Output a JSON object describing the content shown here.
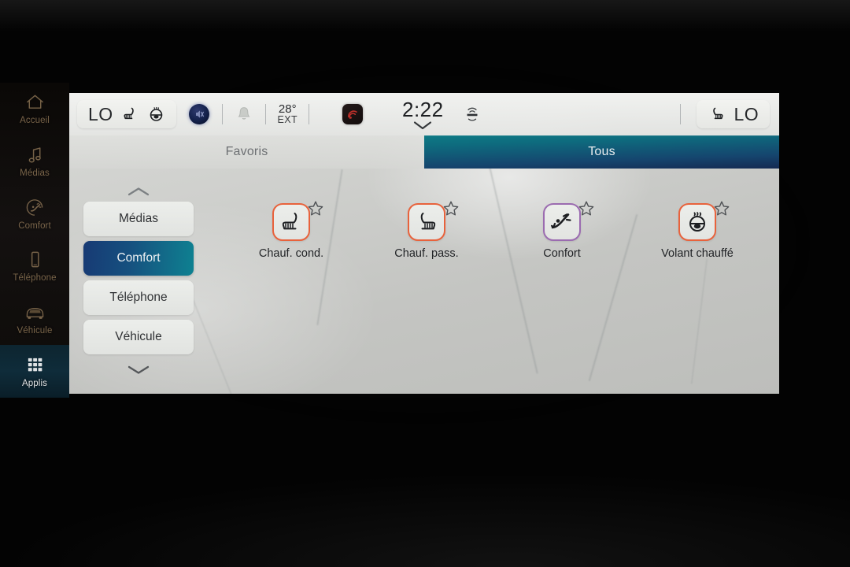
{
  "sidebar": {
    "items": [
      {
        "label": "Accueil",
        "icon": "home-icon",
        "active": false
      },
      {
        "label": "Médias",
        "icon": "music-note-icon",
        "active": false
      },
      {
        "label": "Comfort",
        "icon": "comfort-seat-icon",
        "active": false
      },
      {
        "label": "Téléphone",
        "icon": "phone-icon",
        "active": false
      },
      {
        "label": "Véhicule",
        "icon": "vehicle-icon",
        "active": false
      },
      {
        "label": "Applis",
        "icon": "apps-grid-icon",
        "active": true
      }
    ]
  },
  "statusbar": {
    "left_climate": {
      "level": "LO",
      "icons": [
        "heated-seat-icon",
        "heated-steering-wheel-icon"
      ]
    },
    "volume_icon": "volume-mute-icon",
    "notification_icon": "bell-icon",
    "exterior_temp": {
      "value": "28°",
      "label": "EXT"
    },
    "media_app_icon": "radio-signal-icon",
    "clock": "2:22",
    "clock_chevron_icon": "chevron-down-icon",
    "siriusxm_icon": "siriusxm-icon",
    "right_climate": {
      "icon": "heated-seat-right-icon",
      "level": "LO"
    }
  },
  "tabs": [
    {
      "label": "Favoris",
      "active": false
    },
    {
      "label": "Tous",
      "active": true
    }
  ],
  "categories": {
    "scroll_up_icon": "chevron-up-icon",
    "scroll_down_icon": "chevron-down-icon",
    "items": [
      {
        "label": "Médias",
        "active": false
      },
      {
        "label": "Comfort",
        "active": true
      },
      {
        "label": "Téléphone",
        "active": false
      },
      {
        "label": "Véhicule",
        "active": false
      }
    ]
  },
  "apps": [
    {
      "label": "Chauf. cond.",
      "icon": "heated-seat-driver-icon",
      "border": "orange",
      "favorite": false,
      "favorite_icon": "star-outline-icon"
    },
    {
      "label": "Chauf. pass.",
      "icon": "heated-seat-passenger-icon",
      "border": "orange",
      "favorite": false,
      "favorite_icon": "star-outline-icon"
    },
    {
      "label": "Confort",
      "icon": "comfort-recline-icon",
      "border": "violet",
      "favorite": false,
      "favorite_icon": "star-outline-icon"
    },
    {
      "label": "Volant chauffé",
      "icon": "heated-steering-wheel-icon",
      "border": "orange",
      "favorite": false,
      "favorite_icon": "star-outline-icon"
    }
  ],
  "colors": {
    "accent_orange": "#e8623c",
    "accent_violet": "#9b6bb0",
    "active_tab_teal": "#0d7a85",
    "active_tab_navy": "#152a52",
    "sidebar_gold": "#b8986e"
  }
}
